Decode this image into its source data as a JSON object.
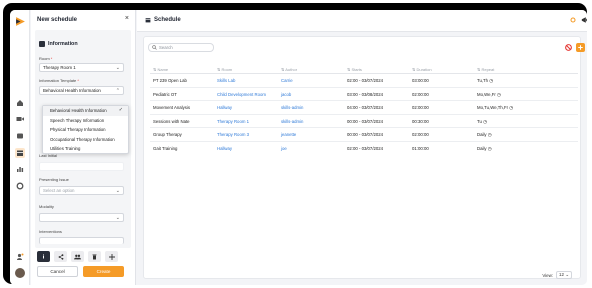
{
  "drawer": {
    "title": "New schedule",
    "close": "×",
    "section_title": "Information",
    "room_label": "Room",
    "room_required": "*",
    "room_value": "Therapy Room 1",
    "template_label": "Information Template",
    "template_required": "*",
    "template_value": "Behavioral Health Information",
    "template_options": [
      "Behavioral Health Information",
      "Speech Therapy Information",
      "Physical Therapy Information",
      "Occupational Therapy Information",
      "Utilities Training"
    ],
    "hidden_field_value": "Last Initial",
    "presenting_label": "Presenting Issue",
    "presenting_placeholder": "Select an option",
    "modality_label": "Modality",
    "interventions_label": "Interventions",
    "cancel_label": "Cancel",
    "create_label": "Create"
  },
  "header": {
    "title": "Schedule"
  },
  "search": {
    "placeholder": "Search"
  },
  "table": {
    "columns": [
      "Name",
      "Room",
      "Author",
      "Starts",
      "Duration",
      "Repeat"
    ],
    "rows": [
      {
        "name": "PT 239 Open Lab",
        "room": "Skills Lab",
        "author": "Carrie",
        "starts": "02:00 - 03/07/2024",
        "duration": "03:00:00",
        "repeat": "Tu,Th"
      },
      {
        "name": "Pediatric OT",
        "room": "Child Development Room",
        "author": "jacob",
        "starts": "03:00 - 03/08/2024",
        "duration": "02:00:00",
        "repeat": "Mo,We,Fr"
      },
      {
        "name": "Movement Analysis",
        "room": "Hallway",
        "author": "skills-admin",
        "starts": "04:00 - 03/07/2024",
        "duration": "02:00:00",
        "repeat": "Mo,Tu,We,Th,Fr"
      },
      {
        "name": "Sessions with Nate",
        "room": "Therapy Room 1",
        "author": "skills-admin",
        "starts": "00:00 - 03/07/2024",
        "duration": "00:30:00",
        "repeat": "Tu"
      },
      {
        "name": "Group Therapy",
        "room": "Therapy Room 3",
        "author": "jeanette",
        "starts": "00:00 - 03/07/2024",
        "duration": "02:00:00",
        "repeat": "Daily"
      },
      {
        "name": "Gait Training",
        "room": "Hallway",
        "author": "joe",
        "starts": "02:00 - 03/07/2024",
        "duration": "01:00:00",
        "repeat": "Daily"
      }
    ]
  },
  "pagination": {
    "view_label": "View:",
    "view_value": "12"
  },
  "colors": {
    "accent": "#f59b27",
    "link": "#2f7ad8",
    "dark": "#2a2f3a"
  }
}
